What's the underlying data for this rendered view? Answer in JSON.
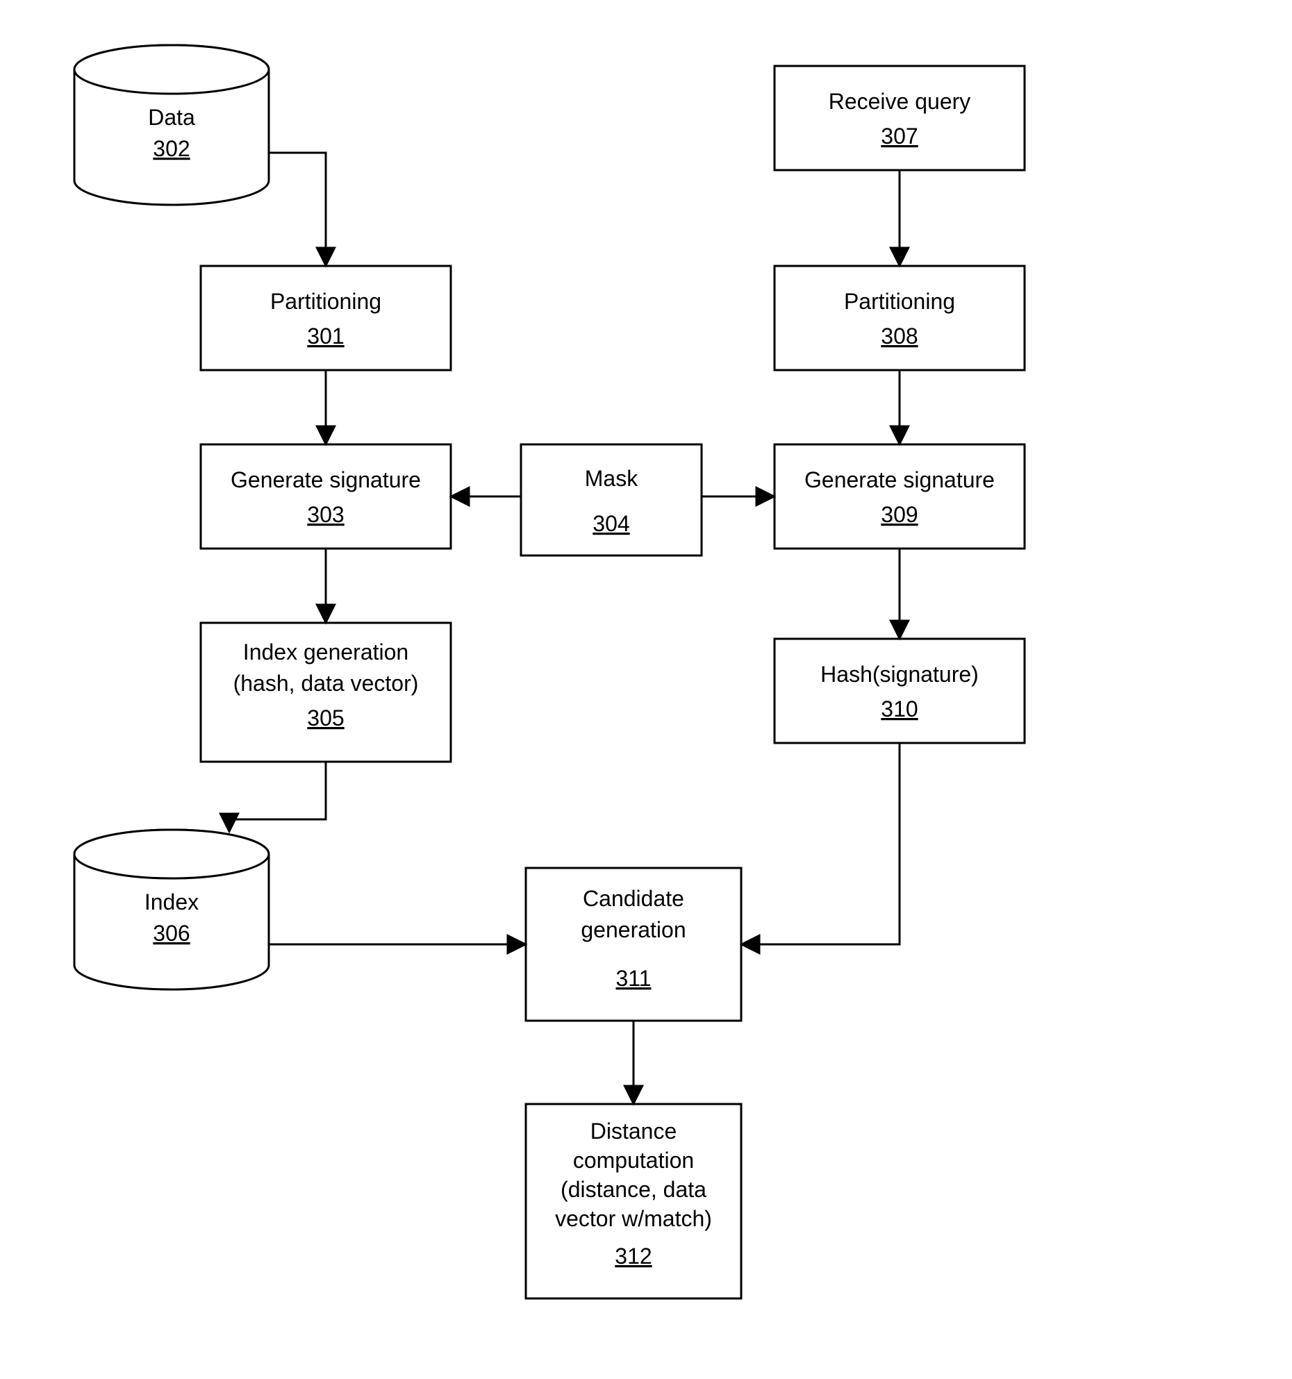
{
  "nodes": {
    "data": {
      "label": "Data",
      "num": "302"
    },
    "part1": {
      "label": "Partitioning",
      "num": "301"
    },
    "gensig1": {
      "label": "Generate signature",
      "num": "303"
    },
    "mask": {
      "label": "Mask",
      "num": "304"
    },
    "indexgen": {
      "label": "Index generation",
      "sub": "(hash, data vector)",
      "num": "305"
    },
    "index": {
      "label": "Index",
      "num": "306"
    },
    "recvq": {
      "label": "Receive query",
      "num": "307"
    },
    "part2": {
      "label": "Partitioning",
      "num": "308"
    },
    "gensig2": {
      "label": "Generate signature",
      "num": "309"
    },
    "hashsig": {
      "label": "Hash(signature)",
      "num": "310"
    },
    "candgen": {
      "label": "Candidate",
      "sub": "generation",
      "num": "311"
    },
    "distcomp": {
      "label": "Distance",
      "sub1": "computation",
      "sub2": "(distance, data",
      "sub3": "vector w/match)",
      "num": "312"
    }
  }
}
